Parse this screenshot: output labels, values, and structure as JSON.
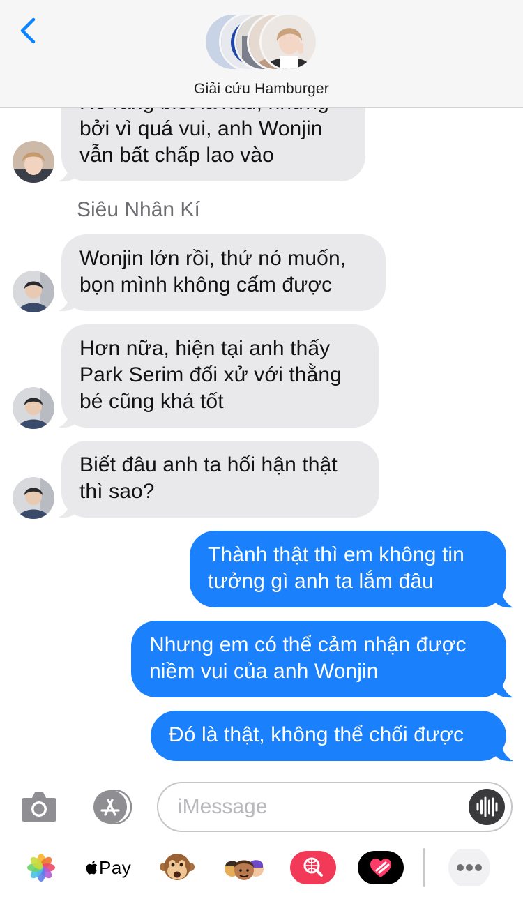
{
  "header": {
    "title": "Giải cứu Hamburger"
  },
  "messages": [
    {
      "direction": "incoming",
      "lines": [
        "Rõ ràng biết là xấu, nhưng",
        "bởi vì quá vui, anh Wonjin",
        "vẫn bất chấp lao vào"
      ]
    },
    {
      "direction": "incoming",
      "sender": "Siêu Nhân Kí",
      "lines": [
        "Wonjin lớn rồi, thứ nó muốn,",
        "bọn mình không cấm được"
      ]
    },
    {
      "direction": "incoming",
      "lines": [
        "Hơn nữa, hiện tại anh thấy",
        "Park Serim đối xử với thằng",
        "bé cũng khá tốt"
      ]
    },
    {
      "direction": "incoming",
      "lines": [
        "Biết đâu anh ta hối hận thật",
        "thì sao?"
      ]
    },
    {
      "direction": "outgoing",
      "lines": [
        "Thành thật thì em không tin",
        "tưởng gì anh ta lắm đâu"
      ]
    },
    {
      "direction": "outgoing",
      "lines": [
        "Nhưng em có thể cảm nhận được",
        "niềm vui của anh Wonjin"
      ]
    },
    {
      "direction": "outgoing",
      "lines": [
        "Đó là thật, không thể chối được"
      ]
    }
  ],
  "composer": {
    "placeholder": "iMessage",
    "icons": [
      "camera-icon",
      "app-store-icon",
      "audio-waveform-icon"
    ]
  },
  "app_drawer": {
    "apple_pay_label": "Pay",
    "icons": [
      "photos-icon",
      "apple-pay-icon",
      "animoji-monkey-icon",
      "memoji-icon",
      "web-search-icon",
      "digital-touch-heart-icon",
      "more-icon"
    ]
  },
  "colors": {
    "outgoing_bubble": "#1a80fb",
    "incoming_bubble": "#e9e9eb",
    "ios_blue": "#0a84ff"
  }
}
